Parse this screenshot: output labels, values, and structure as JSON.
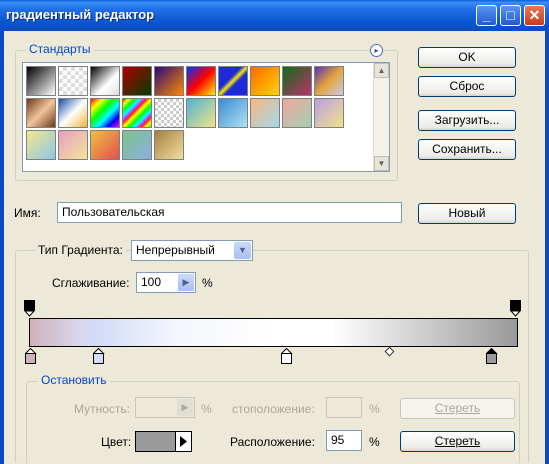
{
  "window": {
    "title": "градиентный редактор",
    "controls": {
      "minimize": "_",
      "maximize": "□",
      "close": "✕"
    }
  },
  "presets": {
    "legend": "Стандарты",
    "menu_icon": "▸",
    "swatches": [
      "linear-gradient(135deg,#000,#fff)",
      "repeating-conic-gradient(#ddd 0 25%,#fff 0 50%) 0 0/8px 8px",
      "linear-gradient(135deg,#000,#fff 60%,#ddd)",
      "linear-gradient(135deg,#b00000,#003f00)",
      "linear-gradient(135deg,#2a0a7a,#ff8a00)",
      "linear-gradient(135deg,#0030ff,#ff0000,#ffee00)",
      "linear-gradient(135deg,#1d2ad8 40%,#ffe600 50%,#1d2ad8 60%)",
      "linear-gradient(135deg,#ff6a00,#ffd200)",
      "linear-gradient(135deg,#0f6c1a,#c0306a)",
      "linear-gradient(135deg,#5a2fb0,#e3a53a,#c9c9f0)",
      "linear-gradient(135deg,#6b3a1b,#f2c49b,#6b3a1b)",
      "linear-gradient(135deg,#1a4aa8,#fff,#f0b43a)",
      "linear-gradient(135deg,#ff0000,#ffff00,#00ff00,#00ffff,#0000ff,#ff00ff)",
      "repeating-linear-gradient(135deg,#ff0000,#ffff00 4px,#00ff00 8px,#00ffff 12px,#ff00ff 16px)",
      "repeating-conic-gradient(#ccc 0 25%,#fff 0 50%) 0 0/6px 6px",
      "linear-gradient(135deg,#4fb3d0,#f0e38a)",
      "linear-gradient(135deg,#3a8bd1,#aee3f5)",
      "linear-gradient(135deg,#f7b77e,#a3d8f0)",
      "linear-gradient(135deg,#f2a7a0,#a0d0b0)",
      "linear-gradient(135deg,#b7a0e0,#f5e08a)",
      "linear-gradient(135deg,#f3e88a,#8dc6e8)",
      "linear-gradient(135deg,#e7a0c0,#f2e39a)",
      "linear-gradient(135deg,#f0c040,#e05050)",
      "linear-gradient(135deg,#7dc38a,#8ab0e0)",
      "linear-gradient(135deg,#a58040,#f0e0a0)"
    ]
  },
  "buttons": {
    "ok": "OK",
    "reset": "Сброс",
    "load": "Загрузить...",
    "save": "Сохранить...",
    "new": "Новый"
  },
  "name_field": {
    "label": "Имя:",
    "value": "Пользовательская"
  },
  "gradient_type": {
    "label": "Тип Градиента:",
    "selected": "Непрерывный",
    "smoothing_label": "Сглаживание:",
    "smoothing_value": "100",
    "smoothing_unit": "%"
  },
  "stops": {
    "legend": "Остановить",
    "opacity_label": "Мутность:",
    "opacity_unit": "%",
    "opacity_location_label": "стоположение:",
    "opacity_location_unit": "%",
    "opacity_delete": "Стереть",
    "color_label": "Цвет:",
    "color_value": "#9b9b9b",
    "location_label": "Расположение:",
    "location_value": "95",
    "location_unit": "%",
    "color_delete": "Стереть"
  },
  "gradient": {
    "opacity_stops": [
      0,
      100
    ],
    "color_stops": [
      {
        "position": 0,
        "color": "#cfb1b8"
      },
      {
        "position": 14,
        "color": "#d3dcf8"
      },
      {
        "position": 52,
        "color": "#ffffff"
      },
      {
        "position": 95,
        "color": "#9b9b9b"
      }
    ],
    "midpoint": 74
  }
}
